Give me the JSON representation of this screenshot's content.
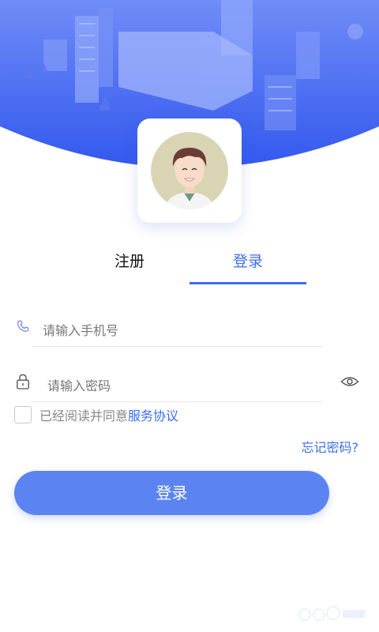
{
  "tabs": {
    "register": "注册",
    "login": "登录",
    "active": "login"
  },
  "phone": {
    "placeholder": "请输入手机号",
    "value": ""
  },
  "password": {
    "placeholder": "请输入密码",
    "value": ""
  },
  "agreement": {
    "prefix": "已经阅读并同意",
    "link": "服务协议",
    "checked": false
  },
  "forgot_password": "忘记密码?",
  "login_button": "登录",
  "colors": {
    "accent": "#3c6df0",
    "button": "#5b84f2",
    "hero": "#4a6cf2"
  }
}
